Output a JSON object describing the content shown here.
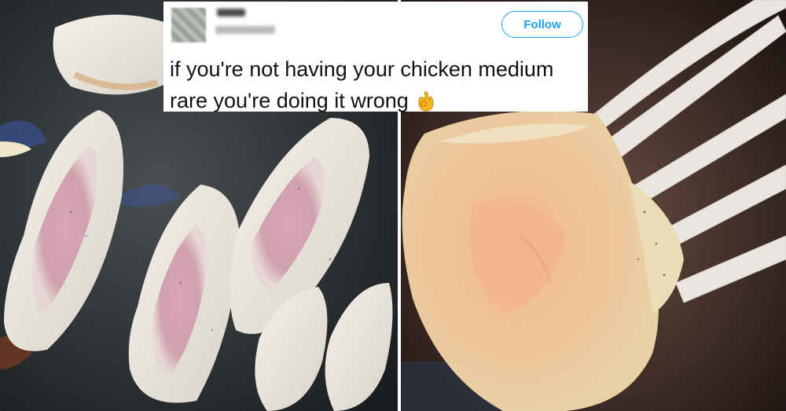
{
  "tweet": {
    "follow_label": "Follow",
    "text_line1": "if you're not having your chicken medium",
    "text_line2": "rare you're doing it wrong",
    "emoji": "ok-hand-emoji"
  },
  "colors": {
    "accent": "#1da1f2",
    "text": "#111111",
    "card_bg": "#ffffff"
  }
}
